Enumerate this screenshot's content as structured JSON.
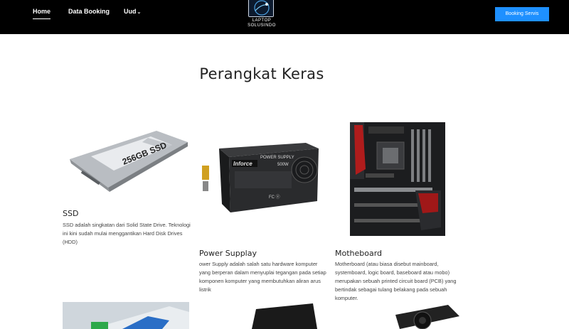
{
  "nav": {
    "home": "Home",
    "data_booking": "Data Booking",
    "uud": "Uud",
    "booking_button": "Booking Servis"
  },
  "logo": {
    "line1": "LAPTOP",
    "line2": "SOLUSINDO"
  },
  "section": {
    "title": "Perangkat Keras"
  },
  "cards": [
    {
      "title": "SSD",
      "desc": "SSD adalah singkatan dari Solid State Drive. Teknologi ini kini sudah mulai menggantikan Hard Disk Drives (HDD)",
      "image_label": "256GB SSD"
    },
    {
      "title": "Power Supplay",
      "desc": "ower Supply adalah salah satu hardware komputer yang berperan dalam menyuplai tegangan pada setiap komponen komputer yang membutuhkan aliran arus listrik",
      "image_brand": "Inforce",
      "image_line1": "POWER SUPPLY",
      "image_line2": "500W"
    },
    {
      "title": "Motheboard",
      "desc": "Motherboard (atau biasa disebut mainboard, systemboard, logic board, baseboard atau mobo) merupakan sebuah printed circuit board (PCB) yang bertindak sebagai tulang belakang pada sebuah komputer."
    }
  ],
  "colors": {
    "navbar": "#000000",
    "accent": "#1e90ff",
    "text": "#222222"
  }
}
